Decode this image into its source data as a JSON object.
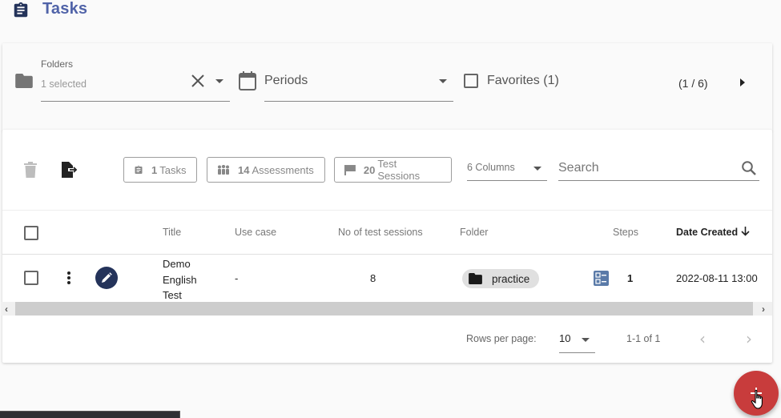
{
  "header": {
    "title": "Tasks",
    "icon": "clipboard-icon"
  },
  "filters": {
    "folders": {
      "label": "Folders",
      "value": "1 selected"
    },
    "periods": {
      "value": "Periods"
    },
    "favorites": {
      "label": "Favorites (1)",
      "checked": false
    },
    "pager": {
      "text": "(1 / 6)"
    }
  },
  "toolbar": {
    "chips": [
      {
        "count": "1",
        "label": "Tasks",
        "icon": "clipboard-icon"
      },
      {
        "count": "14",
        "label": "Assessments",
        "icon": "people-icon"
      },
      {
        "count": "20",
        "label": "Test Sessions",
        "icon": "flag-icon"
      }
    ],
    "columns_select": "6 Columns",
    "search": {
      "placeholder": "Search",
      "value": ""
    }
  },
  "table": {
    "columns": [
      "Title",
      "Use case",
      "No of test sessions",
      "Folder",
      "Steps",
      "Date Created"
    ],
    "sorted_column": "Date Created",
    "sort_direction": "desc",
    "rows": [
      {
        "title_lines": [
          "Demo",
          "English",
          "Test"
        ],
        "use_case": "-",
        "test_sessions": "8",
        "folder": "practice",
        "steps": "1",
        "date_created": "2022-08-11 13:00"
      }
    ]
  },
  "pagination": {
    "rows_per_page_label": "Rows per page:",
    "rows_per_page": "10",
    "range": "1-1 of 1"
  },
  "colors": {
    "title": "#5063a8",
    "edit_button": "#24335a",
    "fab": "#c83c3c",
    "steps_icon": "#5a7aa8"
  }
}
